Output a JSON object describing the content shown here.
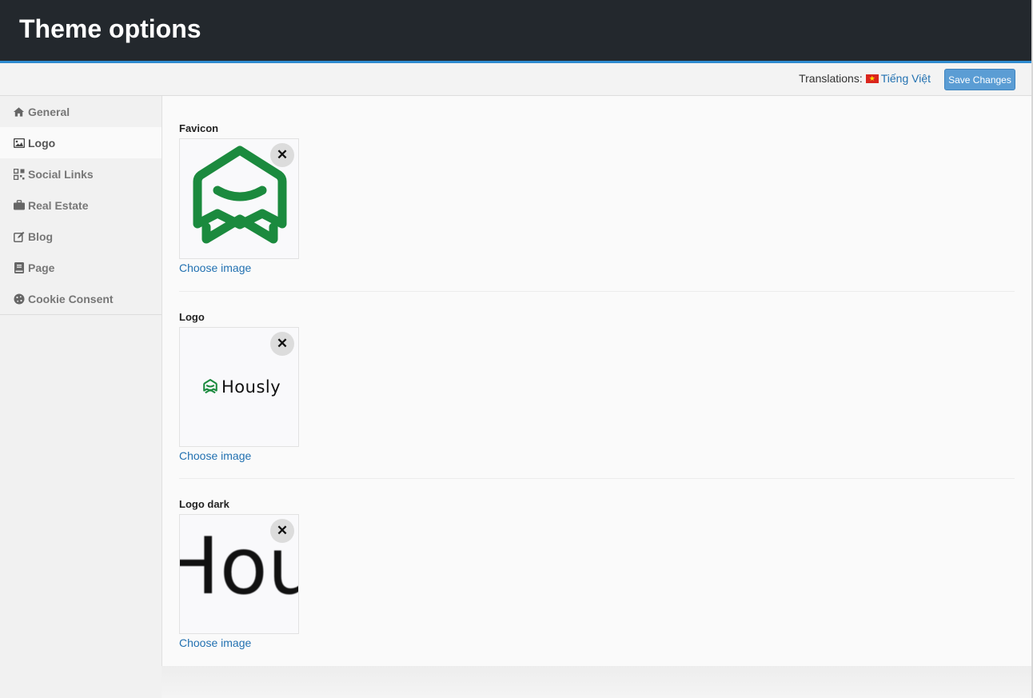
{
  "header": {
    "title": "Theme options"
  },
  "topbar": {
    "translations_label": "Translations:",
    "language": "Tiếng Việt",
    "save_label": "Save Changes"
  },
  "sidebar": {
    "items": [
      {
        "label": "General",
        "icon": "home-icon",
        "active": false
      },
      {
        "label": "Logo",
        "icon": "image-icon",
        "active": true
      },
      {
        "label": "Social Links",
        "icon": "social-links-icon",
        "active": false
      },
      {
        "label": "Real Estate",
        "icon": "briefcase-icon",
        "active": false
      },
      {
        "label": "Blog",
        "icon": "edit-icon",
        "active": false
      },
      {
        "label": "Page",
        "icon": "book-icon",
        "active": false
      },
      {
        "label": "Cookie Consent",
        "icon": "cookie-icon",
        "active": false
      }
    ]
  },
  "fields": [
    {
      "label": "Favicon",
      "choose_label": "Choose image",
      "remove_symbol": "✕"
    },
    {
      "label": "Logo",
      "choose_label": "Choose image",
      "remove_symbol": "✕",
      "logo_text": "Hously"
    },
    {
      "label": "Logo dark",
      "choose_label": "Choose image",
      "remove_symbol": "✕",
      "logo_text": "Hou"
    }
  ],
  "colors": {
    "brand_green": "#1b8a3e",
    "link": "#2271b1",
    "header_bg": "#23282d",
    "accent": "#2e8bd0"
  }
}
